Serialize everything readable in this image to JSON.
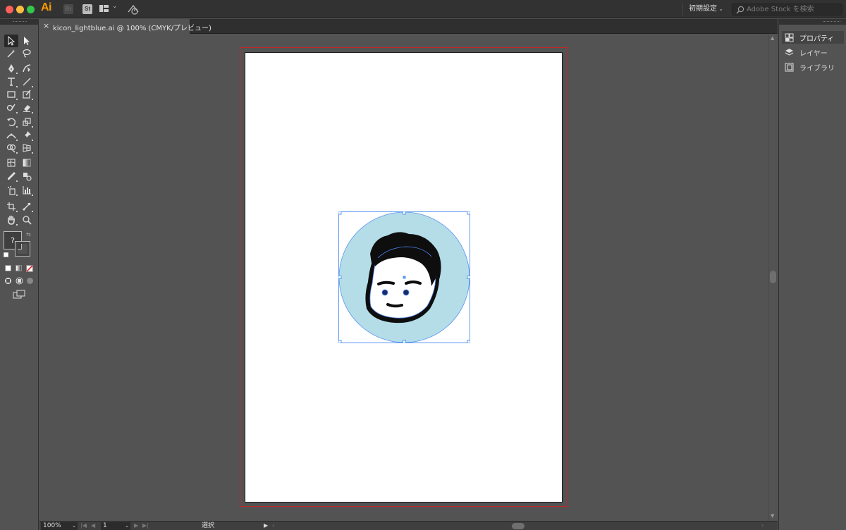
{
  "app": {
    "logo": "Ai",
    "bridge_label": "Br",
    "stock_label": "St",
    "workspace_label": "初期設定",
    "search_placeholder": "Adobe Stock を検索"
  },
  "document": {
    "tab_title": "kicon_lightblue.ai @ 100% (CMYK/プレビュー)",
    "close_glyph": "×"
  },
  "panels": [
    {
      "label": "プロパティ",
      "icon": "properties-icon",
      "active": true
    },
    {
      "label": "レイヤー",
      "icon": "layers-icon",
      "active": false
    },
    {
      "label": "ライブラリ",
      "icon": "libraries-icon",
      "active": false
    }
  ],
  "status": {
    "zoom": "100%",
    "page": "1",
    "tool_name": "選択"
  },
  "colors": {
    "circle_fill": "#b4dde8",
    "selection": "#4f86f7",
    "bleed": "#c3262a",
    "artboard": "#ffffff"
  },
  "toolbar": {
    "fill_stroke_glyph": "?"
  }
}
